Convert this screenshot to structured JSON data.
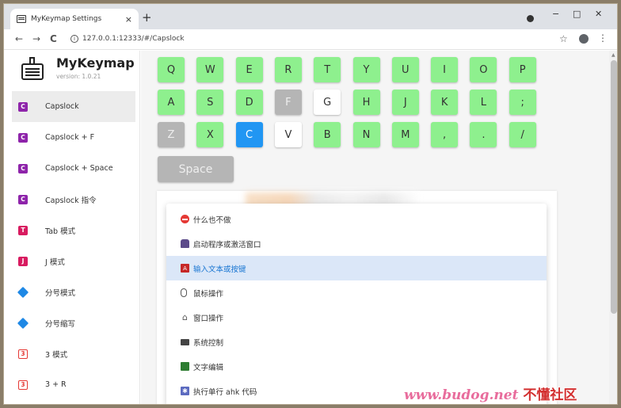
{
  "browser": {
    "tab_title": "MyKeymap Settings",
    "tab_close": "×",
    "new_tab": "+",
    "win_min": "−",
    "win_max": "□",
    "win_close": "✕",
    "back": "←",
    "forward": "→",
    "reload": "C",
    "url": "127.0.0.1:12333/#/Capslock",
    "star": "☆",
    "menu": "⋮"
  },
  "app": {
    "name": "MyKeymap",
    "version": "version: 1.0.21"
  },
  "sidebar": {
    "items": [
      {
        "label": "Capslock",
        "icon": "C",
        "color": "purple",
        "active": true
      },
      {
        "label": "Capslock + F",
        "icon": "C",
        "color": "purple"
      },
      {
        "label": "Capslock + Space",
        "icon": "C",
        "color": "purple"
      },
      {
        "label": "Capslock 指令",
        "icon": "C",
        "color": "purple"
      },
      {
        "label": "Tab 模式",
        "icon": "T",
        "color": "red"
      },
      {
        "label": "J 模式",
        "icon": "J",
        "color": "red"
      },
      {
        "label": "分号模式",
        "icon": "",
        "color": "diamond"
      },
      {
        "label": "分号缩写",
        "icon": "",
        "color": "diamond"
      },
      {
        "label": "3 模式",
        "icon": "3",
        "color": "three"
      },
      {
        "label": "3 + R",
        "icon": "3",
        "color": "three"
      }
    ]
  },
  "keyboard": {
    "row1": [
      "Q",
      "W",
      "E",
      "R",
      "T",
      "Y",
      "U",
      "I",
      "O",
      "P"
    ],
    "row2": [
      "A",
      "S",
      "D",
      "F",
      "G",
      "H",
      "J",
      "K",
      "L",
      ";"
    ],
    "row3": [
      "Z",
      "X",
      "C",
      "V",
      "B",
      "N",
      "M",
      ",",
      ".",
      "/"
    ],
    "space": "Space",
    "states": {
      "F": "disabled",
      "G": "unset",
      "Z": "disabled",
      "C": "selected",
      "V": "unset"
    }
  },
  "dropdown": {
    "items": [
      {
        "label": "什么也不做",
        "icon": "stop"
      },
      {
        "label": "启动程序或激活窗口",
        "icon": "rocket"
      },
      {
        "label": "输入文本或按键",
        "icon": "txt",
        "active": true
      },
      {
        "label": "鼠标操作",
        "icon": "mouse"
      },
      {
        "label": "窗口操作",
        "icon": "house"
      },
      {
        "label": "系统控制",
        "icon": "mon"
      },
      {
        "label": "文字编辑",
        "icon": "book"
      },
      {
        "label": "执行单行 ahk 代码",
        "icon": "gear"
      }
    ]
  },
  "watermark": {
    "site": "www.budog.net",
    "cn": "不懂社区"
  },
  "colors": {
    "key_green": "#8ef08e",
    "key_grey": "#b5b5b5",
    "key_blue": "#2196f3",
    "menu_active": "#dbe7f8"
  }
}
